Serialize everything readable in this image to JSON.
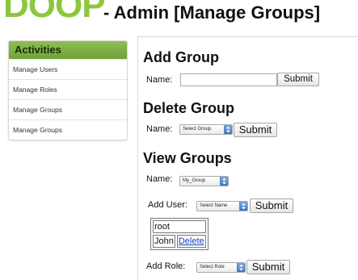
{
  "header": {
    "logo_text": "DOOP",
    "title": "- Admin [Manage Groups]",
    "brand_color": "#8dc63f"
  },
  "sidebar": {
    "title": "Activities",
    "items": [
      {
        "label": "Manage Users"
      },
      {
        "label": "Manage Roles"
      },
      {
        "label": "Manage Groups"
      },
      {
        "label": "Manage Groups"
      }
    ]
  },
  "add_group": {
    "title": "Add Group",
    "name_label": "Name:",
    "name_value": "",
    "submit_label": "Submit"
  },
  "delete_group": {
    "title": "Delete Group",
    "name_label": "Name:",
    "select_value": "Select Group",
    "submit_label": "Submit"
  },
  "view_groups": {
    "title": "View Groups",
    "name_label": "Name:",
    "group_select_value": "My_Group",
    "add_user_label": "Add User:",
    "user_select_value": "Select Name",
    "add_user_submit": "Submit",
    "members": [
      {
        "name": "root",
        "action": ""
      },
      {
        "name": "John",
        "action": "Delete"
      }
    ],
    "add_role_label": "Add Role:",
    "role_select_value": "Select Role",
    "add_role_submit": "Submit"
  },
  "icons": {
    "select_arrows": "up-down-arrows-icon"
  }
}
